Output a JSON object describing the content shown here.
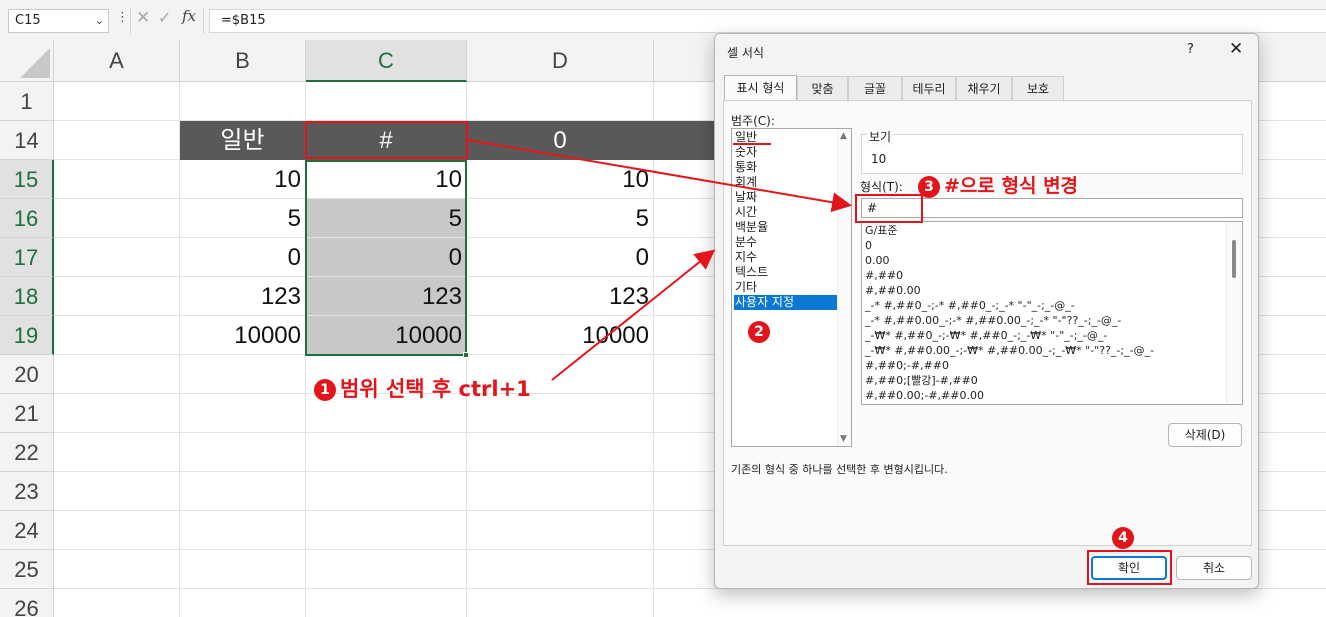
{
  "formula_bar": {
    "name_box": "C15",
    "dots": "⋮",
    "cancel_glyph": "✕",
    "enter_glyph": "✓",
    "fx_glyph": "fx",
    "formula": "=$B15"
  },
  "sheet": {
    "columns": [
      "A",
      "B",
      "C",
      "D"
    ],
    "rows": [
      "1",
      "14",
      "15",
      "16",
      "17",
      "18",
      "19",
      "20",
      "21",
      "22",
      "23",
      "24",
      "25",
      "26"
    ],
    "header_row": {
      "B": "일반",
      "C": "#",
      "D": "0"
    },
    "values": {
      "B": [
        "10",
        "5",
        "0",
        "123",
        "10000"
      ],
      "C": [
        "10",
        "5",
        "0",
        "123",
        "10000"
      ],
      "D": [
        "10",
        "5",
        "0",
        "123",
        "10000"
      ]
    }
  },
  "dialog": {
    "title": "셀 서식",
    "help": "?",
    "close": "✕",
    "tabs": [
      "표시 형식",
      "맞춤",
      "글꼴",
      "테두리",
      "채우기",
      "보호"
    ],
    "category_label": "범주(C):",
    "categories": [
      "일반",
      "숫자",
      "통화",
      "회계",
      "날짜",
      "시간",
      "백분율",
      "분수",
      "지수",
      "텍스트",
      "기타",
      "사용자 지정"
    ],
    "selected_category": "사용자 지정",
    "sample_label": "보기",
    "sample_value": "10",
    "format_label": "형식(T):",
    "format_input": "#",
    "format_list": [
      "G/표준",
      "0",
      "0.00",
      "#,##0",
      "#,##0.00",
      "_-* #,##0_-;-* #,##0_-;_-* \"-\"_-;_-@_-",
      "_-* #,##0.00_-;-* #,##0.00_-;_-* \"-\"??_-;_-@_-",
      "_-₩* #,##0_-;-₩* #,##0_-;_-₩* \"-\"_-;_-@_-",
      "_-₩* #,##0.00_-;-₩* #,##0.00_-;_-₩* \"-\"??_-;_-@_-",
      "#,##0;-#,##0",
      "#,##0;[빨강]-#,##0",
      "#,##0.00;-#,##0.00"
    ],
    "delete_button": "삭제(D)",
    "description": "기존의 형식 중 하나를 선택한 후 변형시킵니다.",
    "ok_button": "확인",
    "cancel_button": "취소"
  },
  "annotations": {
    "step1": {
      "num": "1",
      "text": "범위 선택 후 ctrl+1"
    },
    "step2": {
      "num": "2"
    },
    "step3": {
      "num": "3",
      "text": "#으로 형식 변경"
    },
    "step4": {
      "num": "4"
    },
    "color": "#e3151a"
  },
  "colors": {
    "excel_green": "#1e6e3e",
    "header_fill": "#595959",
    "selection_shade": "#c8c8c8",
    "accent_blue": "#0b78d4"
  }
}
